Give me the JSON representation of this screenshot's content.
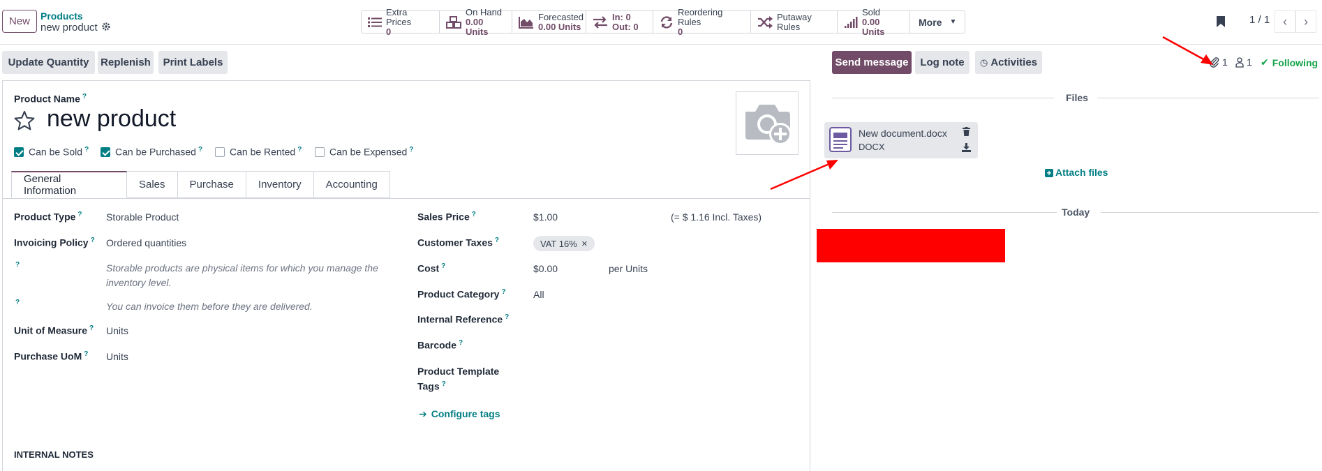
{
  "control": {
    "new_label": "New",
    "breadcrumb_parent": "Products",
    "breadcrumb_current": "new product",
    "smart_buttons": [
      {
        "icon": "list-icon",
        "label": "Extra Prices",
        "value": "0"
      },
      {
        "icon": "cubes-icon",
        "label": "On Hand",
        "value": "0.00 Units"
      },
      {
        "icon": "area-chart-icon",
        "label": "Forecasted",
        "value": "0.00 Units"
      },
      {
        "icon": "exchange-icon",
        "label": "In: 0",
        "value": "Out: 0"
      },
      {
        "icon": "refresh-icon",
        "label": "Reordering Rules",
        "value": "0"
      },
      {
        "icon": "random-icon",
        "label": "Putaway Rules",
        "value": ""
      },
      {
        "icon": "signal-icon",
        "label": "Sold",
        "value": "0.00 Units"
      }
    ],
    "more_label": "More",
    "pager": "1 / 1"
  },
  "toolbar": {
    "update_quantity": "Update Quantity",
    "replenish": "Replenish",
    "print_labels": "Print Labels"
  },
  "form": {
    "product_name_label": "Product Name",
    "product_name": "new product",
    "checkboxes": [
      {
        "label": "Can be Sold",
        "checked": true
      },
      {
        "label": "Can be Purchased",
        "checked": true
      },
      {
        "label": "Can be Rented",
        "checked": false
      },
      {
        "label": "Can be Expensed",
        "checked": false
      }
    ],
    "tabs": [
      "General Information",
      "Sales",
      "Purchase",
      "Inventory",
      "Accounting"
    ],
    "left": {
      "product_type_label": "Product Type",
      "product_type": "Storable Product",
      "invoicing_policy_label": "Invoicing Policy",
      "invoicing_policy": "Ordered quantities",
      "help_storable": "Storable products are physical items for which you manage the inventory level.",
      "help_invoice": "You can invoice them before they are delivered.",
      "uom_label": "Unit of Measure",
      "uom": "Units",
      "purchase_uom_label": "Purchase UoM",
      "purchase_uom": "Units"
    },
    "right": {
      "sales_price_label": "Sales Price",
      "sales_price": "$1.00",
      "incl_taxes": "(= $ 1.16 Incl. Taxes)",
      "customer_taxes_label": "Customer Taxes",
      "tax_tag": "VAT 16%",
      "cost_label": "Cost",
      "cost": "$0.00",
      "cost_unit": "per Units",
      "category_label": "Product Category",
      "category": "All",
      "internal_ref_label": "Internal Reference",
      "barcode_label": "Barcode",
      "tags_label_1": "Product Template",
      "tags_label_2": "Tags",
      "configure_tags": "Configure tags"
    },
    "internal_notes": "INTERNAL NOTES"
  },
  "chatter": {
    "send_message": "Send message",
    "log_note": "Log note",
    "activities": "Activities",
    "attachments_count": "1",
    "followers_count": "1",
    "following": "Following",
    "files_heading": "Files",
    "file_name": "New document.docx",
    "file_type": "DOCX",
    "attach_files": "Attach files",
    "today": "Today"
  },
  "colors": {
    "brand": "#714B67",
    "teal": "#017e84",
    "annotation_red": "#ff0000"
  }
}
